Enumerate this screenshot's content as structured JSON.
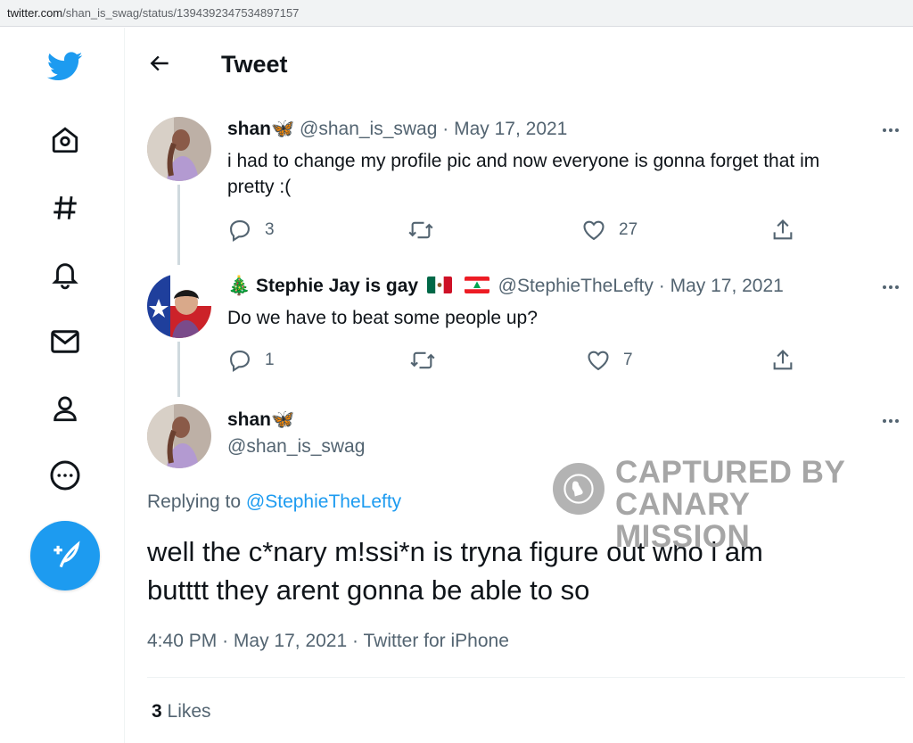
{
  "browser": {
    "url_host": "twitter.com",
    "url_path": "/shan_is_swag/status/1394392347534897157"
  },
  "nav": {
    "items": [
      {
        "name": "twitter-logo-icon"
      },
      {
        "name": "home-icon"
      },
      {
        "name": "explore-hashtag-icon"
      },
      {
        "name": "notifications-bell-icon"
      },
      {
        "name": "messages-envelope-icon"
      },
      {
        "name": "profile-person-icon"
      },
      {
        "name": "more-circle-icon"
      },
      {
        "name": "compose-tweet-icon"
      }
    ]
  },
  "header": {
    "title": "Tweet"
  },
  "tweets": [
    {
      "name": "shan🦋",
      "handle": "@shan_is_swag",
      "sep": "·",
      "date": "May 17, 2021",
      "text_line1": "i had to change my profile pic and now everyone is gonna forget that im",
      "text_line2": "pretty :(",
      "replies": "3",
      "likes": "27"
    },
    {
      "name_prefix": "🎄",
      "name": "Stephie Jay is gay",
      "flags": [
        "mexico-flag",
        "lebanon-flag"
      ],
      "handle": "@StephieTheLefty",
      "sep": "·",
      "date": "May 17, 2021",
      "text": "Do we have to beat some people up?",
      "replies": "1",
      "likes": "7"
    }
  ],
  "main_tweet": {
    "name": "shan🦋",
    "handle": "@shan_is_swag",
    "replying_label": "Replying to",
    "replying_handle": "@StephieTheLefty",
    "text_line1": "well the c*nary m!ssi*n is tryna figure out who i am",
    "text_line2": "butttt they arent gonna be able to so",
    "time": "4:40 PM",
    "sep": "·",
    "date": "May 17, 2021",
    "sep2": "·",
    "source": "Twitter for iPhone",
    "likes_count": "3",
    "likes_label": "Likes"
  },
  "watermark": {
    "line1": "CAPTURED BY",
    "line2": "CANARY MISSION"
  },
  "colors": {
    "accent": "#1d9bf0",
    "muted": "#536471",
    "text": "#0f1419",
    "watermark": "#a6a6a6"
  }
}
